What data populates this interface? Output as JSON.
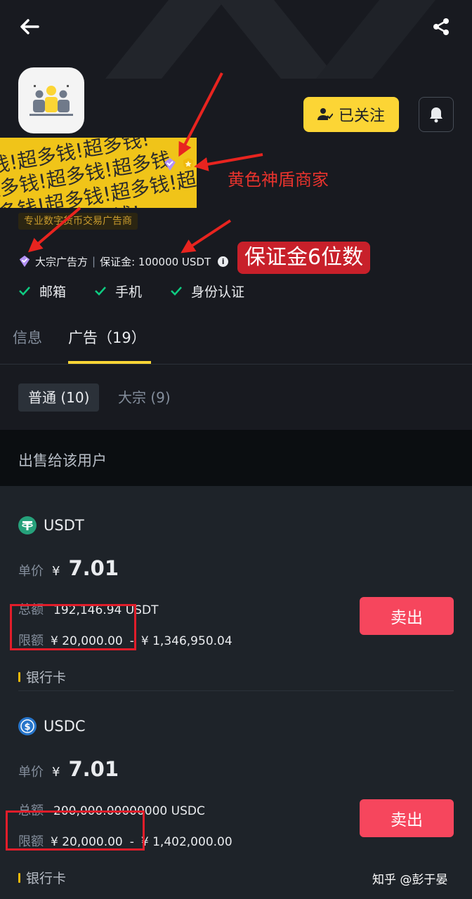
{
  "header": {
    "back_icon": "arrow-left-icon",
    "share_icon": "share-icon"
  },
  "profile": {
    "avatar_icon": "user-group-icon",
    "follow_label": "已关注",
    "bell_icon": "bell-icon",
    "merchant_tag": "专业数字货币交易广告商",
    "advertiser_type": "大宗广告方",
    "deposit_text": "保证金: 100000 USDT",
    "verifications": [
      "邮箱",
      "手机",
      "身份认证"
    ]
  },
  "annotations": {
    "shield_merchant": "黄色神盾商家",
    "deposit_digits": "保证金6位数"
  },
  "tabs": [
    {
      "label": "信息",
      "active": false
    },
    {
      "label": "广告（19）",
      "active": true
    }
  ],
  "subtabs": [
    {
      "label": "普通 (10)",
      "active": true
    },
    {
      "label": "大宗 (9)",
      "active": false
    }
  ],
  "section_title": "出售给该用户",
  "ads": [
    {
      "coin": "USDT",
      "coin_icon": "tether-icon",
      "coin_color": "#26a17b",
      "price_label": "单价",
      "currency": "¥",
      "price": "7.01",
      "total_label": "总额",
      "total": "192,146.94 USDT",
      "limit_label": "限额",
      "limit_min": "¥ 20,000.00",
      "limit_sep": "-",
      "limit_max": "¥ 1,346,950.04",
      "payment": "银行卡",
      "action": "卖出"
    },
    {
      "coin": "USDC",
      "coin_icon": "usdc-icon",
      "coin_color": "#2775ca",
      "price_label": "单价",
      "currency": "¥",
      "price": "7.01",
      "total_label": "总额",
      "total": "200,000.00000000 USDC",
      "limit_label": "限额",
      "limit_min": "¥ 20,000.00",
      "limit_sep": "-",
      "limit_max": "¥ 1,402,000.00",
      "payment": "银行卡",
      "action": "卖出"
    }
  ],
  "watermark": "知乎 @彭于晏",
  "colors": {
    "accent": "#fcd535",
    "sell": "#f6465d",
    "verify_check": "#0ecb81",
    "annotation_red": "#e8332d"
  }
}
